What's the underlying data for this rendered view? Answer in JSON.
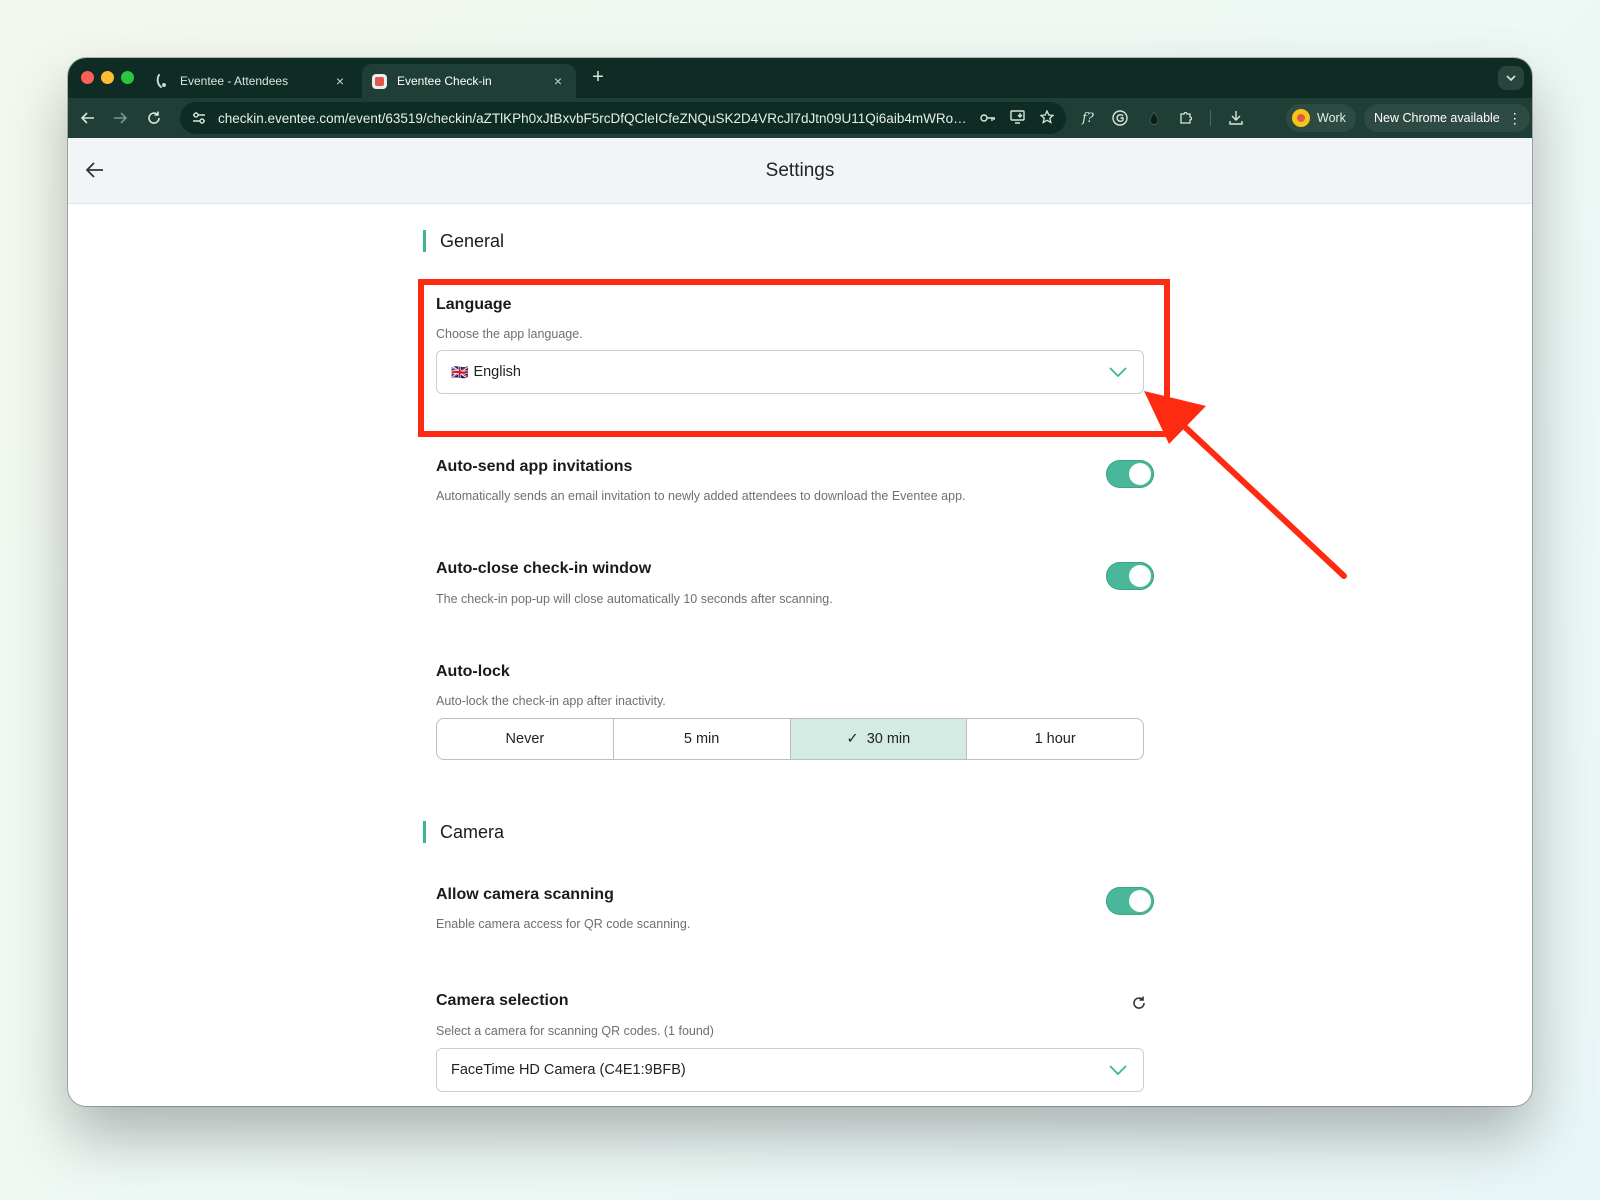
{
  "browser": {
    "tabs": [
      {
        "title": "Eventee - Attendees",
        "active": false
      },
      {
        "title": "Eventee Check-in",
        "active": true
      }
    ],
    "new_tab_symbol": "+",
    "tab_close_symbol": "×",
    "url": "checkin.eventee.com/event/63519/checkin/aZTlKPh0xJtBxvbF5rcDfQCleICfeZNQuSK2D4VRcJl7dJtn09U11Qi6aib4mWRob...",
    "profile_label": "Work",
    "update_label": "New Chrome available",
    "update_menu_symbol": "⋮"
  },
  "header": {
    "title": "Settings"
  },
  "general": {
    "section_title": "General",
    "language": {
      "title": "Language",
      "description": "Choose the app language.",
      "flag": "🇬🇧",
      "value": "English"
    },
    "auto_send": {
      "title": "Auto-send app invitations",
      "description": "Automatically sends an email invitation to newly added attendees to download the Eventee app.",
      "enabled": true
    },
    "auto_close": {
      "title": "Auto-close check-in window",
      "description": "The check-in pop-up will close automatically 10 seconds after scanning.",
      "enabled": true
    },
    "auto_lock": {
      "title": "Auto-lock",
      "description": "Auto-lock the check-in app after inactivity.",
      "options": [
        "Never",
        "5 min",
        "30 min",
        "1 hour"
      ],
      "selected": "30 min",
      "check_symbol": "✓"
    }
  },
  "camera": {
    "section_title": "Camera",
    "allow_scanning": {
      "title": "Allow camera scanning",
      "description": "Enable camera access for QR code scanning.",
      "enabled": true
    },
    "selection": {
      "title": "Camera selection",
      "description": "Select a camera for scanning QR codes. (1 found)",
      "value": "FaceTime HD Camera (C4E1:9BFB)"
    }
  },
  "colors": {
    "accent": "#3cb595",
    "toggle_on": "#4bb79a",
    "annotation": "#ff2a12",
    "selected_segment": "#d3ebe3",
    "browser_frame": "#0e2b24"
  }
}
